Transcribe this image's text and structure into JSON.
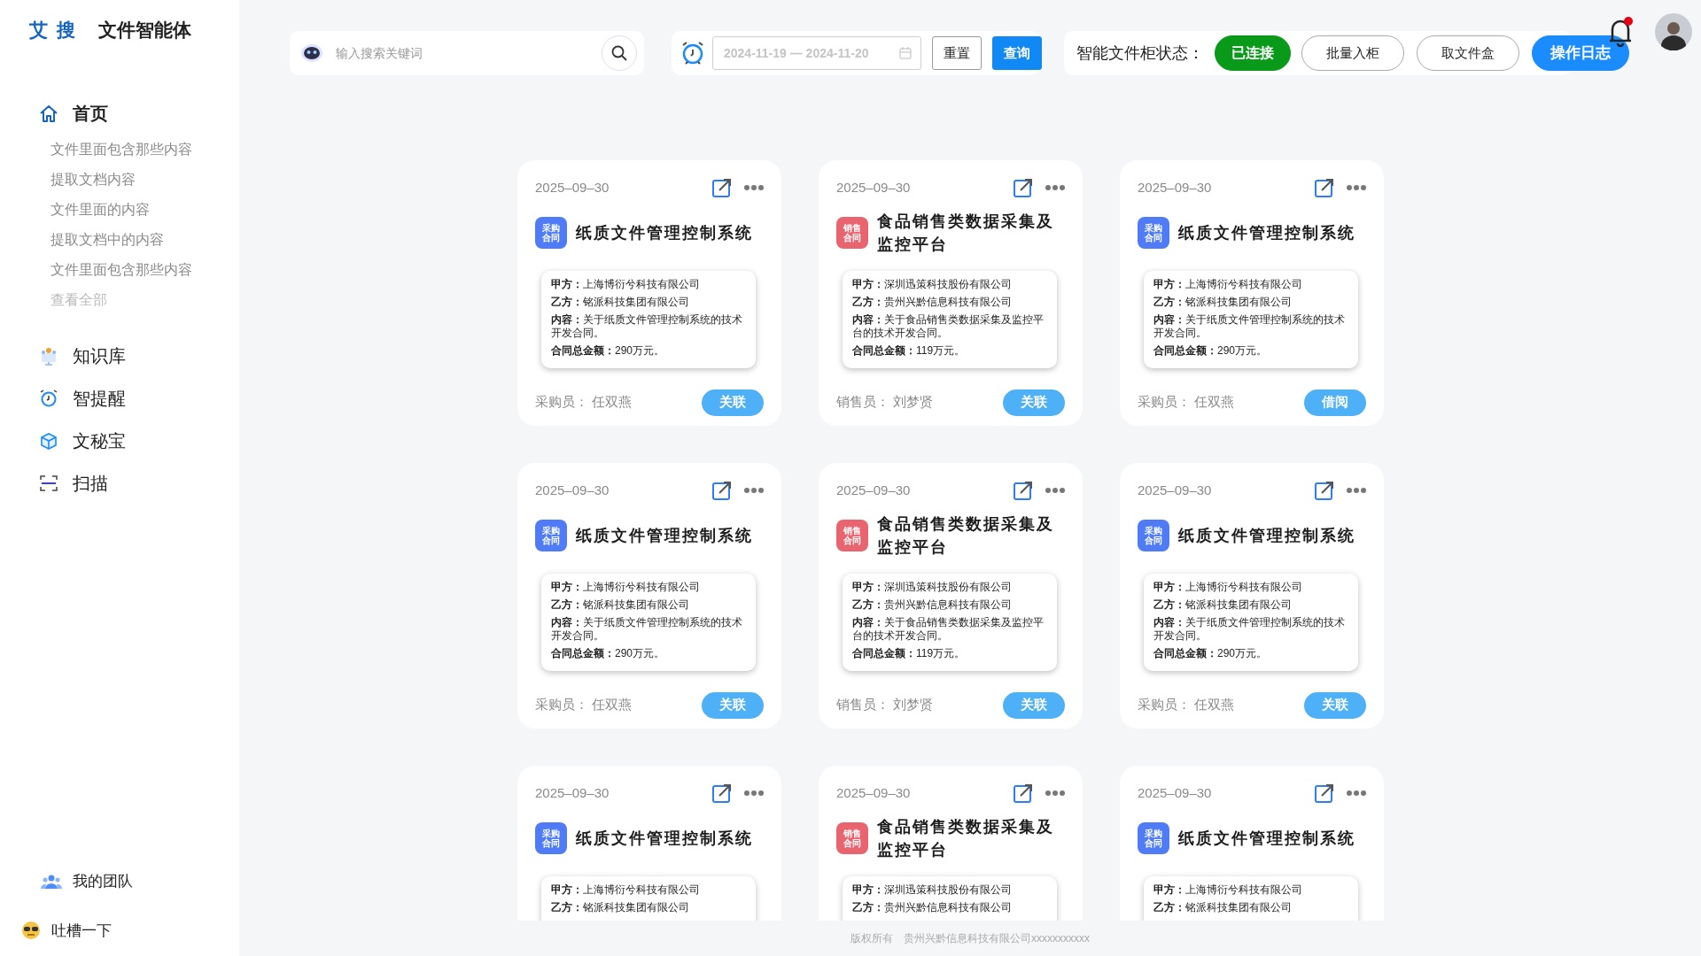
{
  "brand": {
    "logo": "艾 搜",
    "title": "文件智能体"
  },
  "sidebar": {
    "items": [
      {
        "label": "首页",
        "kind": "home",
        "selected": true,
        "children": [
          {
            "label": "文件里面包含那些内容"
          },
          {
            "label": "提取文档内容"
          },
          {
            "label": "文件里面的内容"
          },
          {
            "label": "提取文档中的内容"
          },
          {
            "label": "文件里面包含那些内容"
          }
        ],
        "view_all": "查看全部"
      },
      {
        "label": "知识库",
        "kind": "knowledge",
        "selected": false
      },
      {
        "label": "智提醒",
        "kind": "alarm",
        "selected": false
      },
      {
        "label": "文秘宝",
        "kind": "box",
        "selected": false
      },
      {
        "label": "扫描",
        "kind": "scan",
        "selected": false
      }
    ],
    "bottom": [
      {
        "label": "我的团队",
        "kind": "team"
      },
      {
        "label": "吐槽一下",
        "kind": "feedback"
      }
    ]
  },
  "search": {
    "placeholder": "输入搜索关键词"
  },
  "date_filter": {
    "placeholder": "2024-11-19 — 2024-11-20",
    "buttons": [
      {
        "label": "重置",
        "kind": "outline"
      },
      {
        "label": "查询",
        "kind": "primary"
      }
    ]
  },
  "cabinet": {
    "label": "智能文件柜状态：",
    "status": "已连接",
    "connected": true,
    "buttons": [
      {
        "label": "批量入柜",
        "kind": "outline"
      },
      {
        "label": "取文件盒",
        "kind": "outline"
      },
      {
        "label": "操作日志",
        "kind": "primary"
      }
    ]
  },
  "notifications": {
    "unread": true
  },
  "cards": [
    {
      "date": "2025–09–30",
      "tag": "采购合同",
      "color": "#4f7cf6",
      "title": "纸质文件管理控制系统",
      "fields": [
        "**甲方：**上海博衍兮科技有限公司",
        "**乙方：**铭派科技集团有限公司",
        "**内容：**关于纸质文件管理控制系统的技术开发合同。",
        "**合同总金额：**290万元。"
      ],
      "person_label": "采购员：",
      "person": "任双燕",
      "action": "关联"
    },
    {
      "date": "2025–09–30",
      "tag": "销售合同",
      "color": "#e8646e",
      "title": "食品销售类数据采集及监控平台",
      "fields": [
        "**甲方：**深圳迅策科技股份有限公司",
        "**乙方：**贵州兴黔信息科技有限公司",
        "**内容：**关于食品销售类数据采集及监控平台的技术开发合同。",
        "**合同总金额：**119万元。"
      ],
      "person_label": "销售员：",
      "person": "刘梦贤",
      "action": "关联"
    },
    {
      "date": "2025–09–30",
      "tag": "采购合同",
      "color": "#4f7cf6",
      "title": "纸质文件管理控制系统",
      "fields": [
        "**甲方：**上海博衍兮科技有限公司",
        "**乙方：**铭派科技集团有限公司",
        "**内容：**关于纸质文件管理控制系统的技术开发合同。",
        "**合同总金额：**290万元。"
      ],
      "person_label": "采购员：",
      "person": "任双燕",
      "action": "借阅"
    },
    {
      "date": "2025–09–30",
      "tag": "采购合同",
      "color": "#4f7cf6",
      "title": "纸质文件管理控制系统",
      "fields": [
        "**甲方：**上海博衍兮科技有限公司",
        "**乙方：**铭派科技集团有限公司",
        "**内容：**关于纸质文件管理控制系统的技术开发合同。",
        "**合同总金额：**290万元。"
      ],
      "person_label": "采购员：",
      "person": "任双燕",
      "action": "关联"
    },
    {
      "date": "2025–09–30",
      "tag": "销售合同",
      "color": "#e8646e",
      "title": "食品销售类数据采集及监控平台",
      "fields": [
        "**甲方：**深圳迅策科技股份有限公司",
        "**乙方：**贵州兴黔信息科技有限公司",
        "**内容：**关于食品销售类数据采集及监控平台的技术开发合同。",
        "**合同总金额：**119万元。"
      ],
      "person_label": "销售员：",
      "person": "刘梦贤",
      "action": "关联"
    },
    {
      "date": "2025–09–30",
      "tag": "采购合同",
      "color": "#4f7cf6",
      "title": "纸质文件管理控制系统",
      "fields": [
        "**甲方：**上海博衍兮科技有限公司",
        "**乙方：**铭派科技集团有限公司",
        "**内容：**关于纸质文件管理控制系统的技术开发合同。",
        "**合同总金额：**290万元。"
      ],
      "person_label": "采购员：",
      "person": "任双燕",
      "action": "关联"
    },
    {
      "date": "2025–09–30",
      "tag": "采购合同",
      "color": "#4f7cf6",
      "title": "纸质文件管理控制系统",
      "fields": [
        "**甲方：**上海博衍兮科技有限公司",
        "**乙方：**铭派科技集团有限公司"
      ]
    },
    {
      "date": "2025–09–30",
      "tag": "销售合同",
      "color": "#e8646e",
      "title": "食品销售类数据采集及监控平台",
      "fields": [
        "**甲方：**深圳迅策科技股份有限公司",
        "**乙方：**贵州兴黔信息科技有限公司"
      ]
    },
    {
      "date": "2025–09–30",
      "tag": "采购合同",
      "color": "#4f7cf6",
      "title": "纸质文件管理控制系统",
      "fields": [
        "**甲方：**上海博衍兮科技有限公司",
        "**乙方：**铭派科技集团有限公司"
      ]
    }
  ],
  "footer": {
    "label": "版权所有",
    "company": "贵州兴黔信息科技有限公司xxxxxxxxxxx"
  }
}
